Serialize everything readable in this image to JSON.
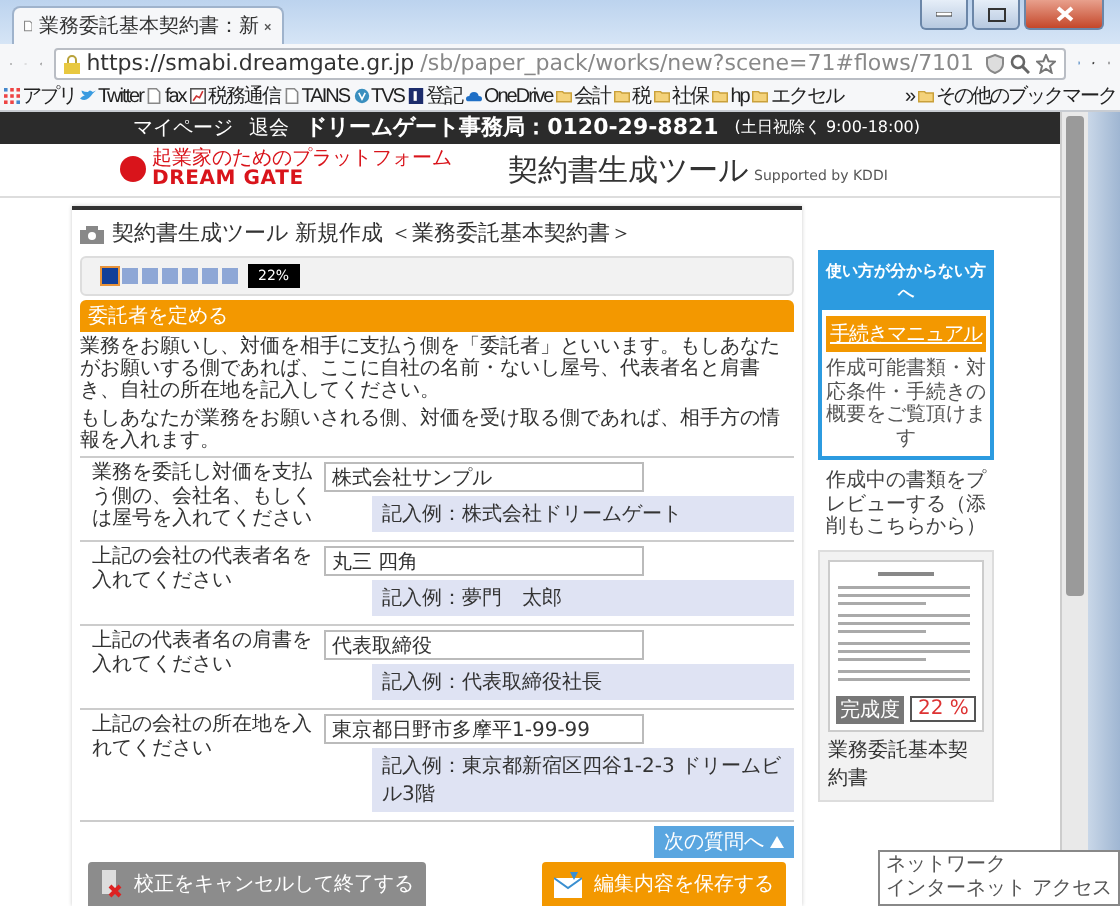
{
  "browser": {
    "tab_title": "業務委託基本契約書：新",
    "url_host": "https://smabi.dreamgate.gr.jp",
    "url_path": "/sb/paper_pack/works/new?scene=71#flows/7101",
    "bookmarks": [
      {
        "label": "アプリ",
        "kind": "apps"
      },
      {
        "label": "Twitter",
        "kind": "bird"
      },
      {
        "label": "fax",
        "kind": "page"
      },
      {
        "label": "税務通信",
        "kind": "chart"
      },
      {
        "label": "TAINS",
        "kind": "page"
      },
      {
        "label": "TVS",
        "kind": "circle"
      },
      {
        "label": "登記",
        "kind": "book"
      },
      {
        "label": "OneDrive",
        "kind": "cloud"
      },
      {
        "label": "会計",
        "kind": "folder"
      },
      {
        "label": "税",
        "kind": "folder"
      },
      {
        "label": "社保",
        "kind": "folder"
      },
      {
        "label": "hp",
        "kind": "folder"
      },
      {
        "label": "エクセル",
        "kind": "folder"
      },
      {
        "label": "»",
        "kind": "more"
      },
      {
        "label": "その他のブックマーク",
        "kind": "folder"
      }
    ]
  },
  "top_bar": {
    "links": [
      "マイページ",
      "退会"
    ],
    "contact": "ドリームゲート事務局：0120-29-8821",
    "hours": "(土日祝除く 9:00-18:00)"
  },
  "header": {
    "logo_tagline": "起業家のためのプラットフォーム",
    "logo": "DREAM GATE",
    "title": "契約書生成ツール",
    "supported": "Supported by KDDI"
  },
  "main": {
    "title": "契約書生成ツール 新規作成 ＜業務委託基本契約書＞",
    "steps": [
      {
        "selected": true
      },
      {
        "selected": false
      },
      {
        "selected": false
      },
      {
        "selected": false
      },
      {
        "selected": false
      },
      {
        "selected": false
      },
      {
        "selected": false
      }
    ],
    "progress_label": "22%",
    "section_heading": "委託者を定める",
    "paragraphs": [
      "業務をお願いし、対価を相手に支払う側を「委託者」といいます。もしあなたがお願いする側であれば、ここに自社の名前・ないし屋号、代表者名と肩書き、自社の所在地を記入してください。",
      "もしあなたが業務をお願いされる側、対価を受け取る側であれば、相手方の情報を入れます。"
    ],
    "questions": [
      {
        "label": "業務を委託し対価を支払う側の、会社名、もしくは屋号を入れてください",
        "value": "株式会社サンプル",
        "example": "記入例：株式会社ドリームゲート"
      },
      {
        "label": "上記の会社の代表者名を入れてください",
        "value": "丸三 四角",
        "example": "記入例：夢門　太郎"
      },
      {
        "label": "上記の代表者名の肩書を入れてください",
        "value": "代表取締役",
        "example": "記入例：代表取締役社長"
      },
      {
        "label": "上記の会社の所在地を入れてください",
        "value": "東京都日野市多摩平1-99-99",
        "example": "記入例：東京都新宿区四谷1-2-3 ドリームビル3階"
      }
    ],
    "next_link": "次の質問へ",
    "cancel_button": "校正をキャンセルして終了する",
    "save_button": "編集内容を保存する"
  },
  "sidebar": {
    "help_title": "使い方が分からない方へ",
    "manual_button": "手続きマニュアル",
    "help_text": "作成可能書類・対応条件・手続きの概要をご覧頂けます",
    "preview_title": "作成中の書類をプレビューする（添削もこちらから）",
    "completion_label": "完成度",
    "completion_value": "22 %",
    "document_name": "業務委託基本契約書"
  },
  "tooltip": [
    "ネットワーク",
    "インターネット アクセス"
  ]
}
